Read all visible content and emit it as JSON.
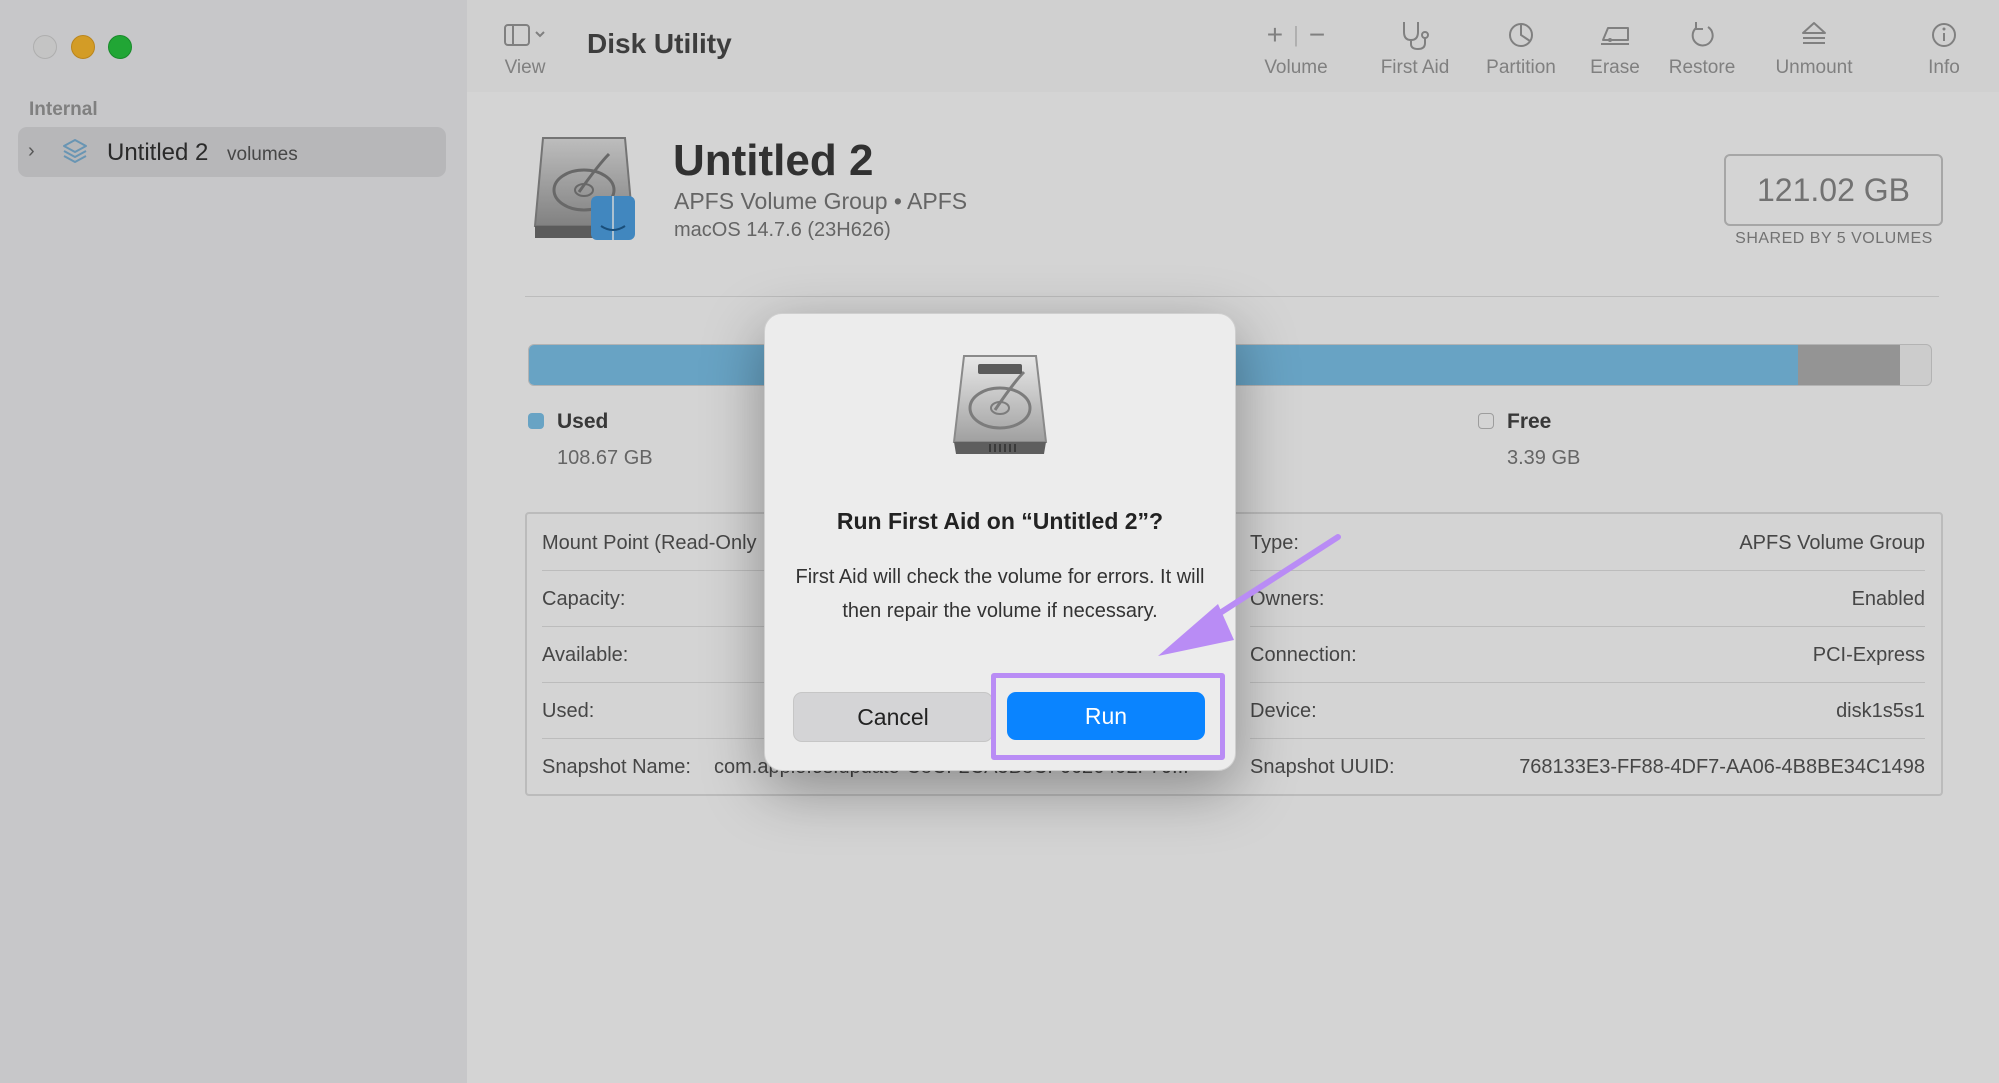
{
  "sidebar": {
    "section_label": "Internal",
    "items": [
      {
        "label": "Untitled 2",
        "sublabel": "volumes"
      }
    ]
  },
  "toolbar": {
    "app_title": "Disk Utility",
    "view_label": "View",
    "volume_label": "Volume",
    "first_aid_label": "First Aid",
    "partition_label": "Partition",
    "erase_label": "Erase",
    "restore_label": "Restore",
    "unmount_label": "Unmount",
    "info_label": "Info"
  },
  "volume": {
    "name": "Untitled 2",
    "type_line": "APFS Volume Group • APFS",
    "os_line": "macOS 14.7.6 (23H626)",
    "capacity": "121.02 GB",
    "capacity_note": "SHARED BY 5 VOLUMES"
  },
  "usage": {
    "used_label": "Used",
    "used_value": "108.67 GB",
    "free_label": "Free",
    "free_value": "3.39 GB",
    "used_fraction": 0.905,
    "other_fraction": 0.073,
    "used_color": "#7ec4ec",
    "other_color": "#b3b3b3"
  },
  "info": {
    "left": [
      {
        "key": "Mount Point (Read-Only",
        "value": ""
      },
      {
        "key": "Capacity:",
        "value": ""
      },
      {
        "key": "Available:",
        "value": ""
      },
      {
        "key": "Used:",
        "value": ""
      },
      {
        "key": "Snapshot Name:",
        "value": "com.apple.os.update-C8CF2CA5B8CF6626492F70..."
      }
    ],
    "right": [
      {
        "key": "Type:",
        "value": "APFS Volume Group"
      },
      {
        "key": "Owners:",
        "value": "Enabled"
      },
      {
        "key": "Connection:",
        "value": "PCI-Express"
      },
      {
        "key": "Device:",
        "value": "disk1s5s1"
      },
      {
        "key": "Snapshot UUID:",
        "value": "768133E3-FF88-4DF7-AA06-4B8BE34C1498"
      }
    ]
  },
  "dialog": {
    "title": "Run First Aid on “Untitled 2”?",
    "message": "First Aid will check the volume for errors. It will then repair the volume if necessary.",
    "cancel_label": "Cancel",
    "run_label": "Run"
  },
  "colors": {
    "accent": "#0a84ff",
    "annotation": "#b98cf5"
  }
}
